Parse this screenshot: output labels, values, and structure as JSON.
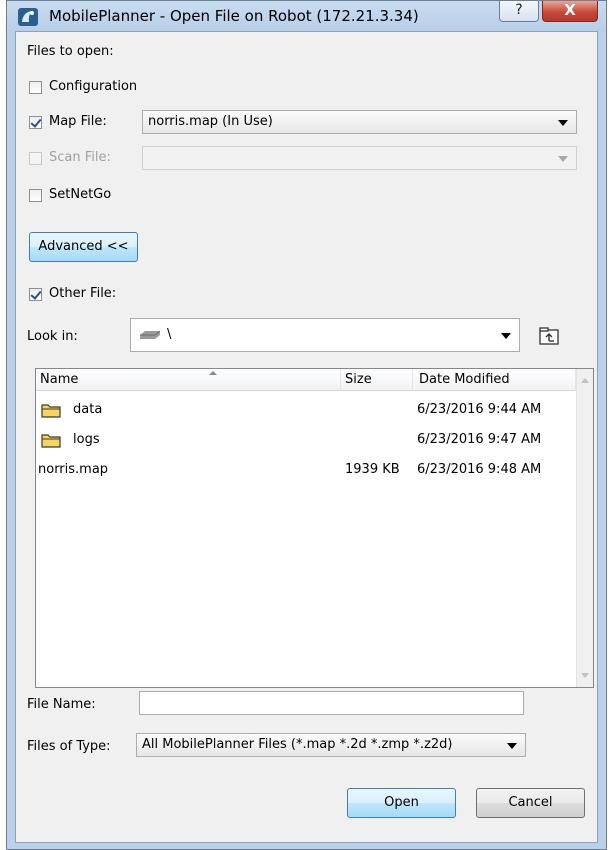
{
  "window": {
    "title": "MobilePlanner - Open File on Robot (172.21.3.34)",
    "help_label": "?",
    "close_label": "X"
  },
  "files_section": {
    "heading": "Files to open:",
    "configuration_label": "Configuration",
    "configuration_checked": false,
    "map_file_label": "Map File:",
    "map_file_checked": true,
    "map_file_value": "norris.map  (In Use)",
    "scan_file_label": "Scan File:",
    "scan_file_checked": false,
    "scan_file_enabled": false,
    "scan_file_value": "",
    "setnetgo_label": "SetNetGo",
    "setnetgo_checked": false
  },
  "advanced_button_label": "Advanced <<",
  "other_file": {
    "label": "Other File:",
    "checked": true
  },
  "look_in": {
    "label": "Look in:",
    "value": "\\",
    "drive_icon": "drive-icon",
    "up_folder_icon": "up-folder-icon"
  },
  "file_list": {
    "columns": [
      "Name",
      "Size",
      "Date Modified"
    ],
    "sort_column": "Name",
    "rows": [
      {
        "name": "data",
        "size": "",
        "date": "6/23/2016 9:44 AM",
        "icon": "folder-icon"
      },
      {
        "name": "logs",
        "size": "",
        "date": "6/23/2016 9:47 AM",
        "icon": "folder-icon"
      },
      {
        "name": "norris.map",
        "size": "1939 KB",
        "date": "6/23/2016 9:48 AM",
        "icon": ""
      }
    ]
  },
  "file_name": {
    "label": "File Name:",
    "value": ""
  },
  "files_of_type": {
    "label": "Files of Type:",
    "value": "All MobilePlanner Files (*.map  *.2d *.zmp *.z2d)"
  },
  "buttons": {
    "open": "Open",
    "cancel": "Cancel"
  },
  "colors": {
    "titlebar": "#b9d1ea",
    "close_button": "#c7493b",
    "dialog_background": "#f0f0f0",
    "advanced_button": "#bee6fd",
    "folder": "#f6d75b"
  }
}
